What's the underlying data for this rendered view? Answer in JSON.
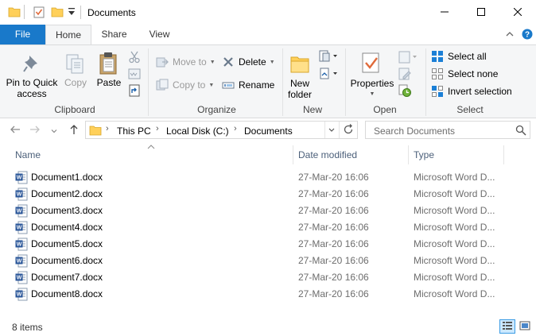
{
  "window": {
    "title": "Documents"
  },
  "ribbon_tabs": {
    "file": "File",
    "home": "Home",
    "share": "Share",
    "view": "View"
  },
  "ribbon": {
    "clipboard": {
      "label": "Clipboard",
      "pin_line1": "Pin to Quick",
      "pin_line2": "access",
      "copy": "Copy",
      "paste": "Paste"
    },
    "organize": {
      "label": "Organize",
      "move_to": "Move to",
      "copy_to": "Copy to",
      "delete": "Delete",
      "rename": "Rename"
    },
    "new": {
      "label": "New",
      "new_folder_line1": "New",
      "new_folder_line2": "folder"
    },
    "open": {
      "label": "Open",
      "properties": "Properties"
    },
    "select": {
      "label": "Select",
      "select_all": "Select all",
      "select_none": "Select none",
      "invert_selection": "Invert selection"
    }
  },
  "address": {
    "crumbs": [
      "This PC",
      "Local Disk (C:)",
      "Documents"
    ],
    "search_placeholder": "Search Documents"
  },
  "columns": {
    "name": "Name",
    "date_modified": "Date modified",
    "type": "Type"
  },
  "files": [
    {
      "name": "Document1.docx",
      "date": "27-Mar-20 16:06",
      "type": "Microsoft Word D..."
    },
    {
      "name": "Document2.docx",
      "date": "27-Mar-20 16:06",
      "type": "Microsoft Word D..."
    },
    {
      "name": "Document3.docx",
      "date": "27-Mar-20 16:06",
      "type": "Microsoft Word D..."
    },
    {
      "name": "Document4.docx",
      "date": "27-Mar-20 16:06",
      "type": "Microsoft Word D..."
    },
    {
      "name": "Document5.docx",
      "date": "27-Mar-20 16:06",
      "type": "Microsoft Word D..."
    },
    {
      "name": "Document6.docx",
      "date": "27-Mar-20 16:06",
      "type": "Microsoft Word D..."
    },
    {
      "name": "Document7.docx",
      "date": "27-Mar-20 16:06",
      "type": "Microsoft Word D..."
    },
    {
      "name": "Document8.docx",
      "date": "27-Mar-20 16:06",
      "type": "Microsoft Word D..."
    }
  ],
  "status": {
    "item_count": "8 items"
  },
  "colors": {
    "file_tab": "#1979ca",
    "word_icon": "#2b579a",
    "folder": "#ffd05a"
  }
}
